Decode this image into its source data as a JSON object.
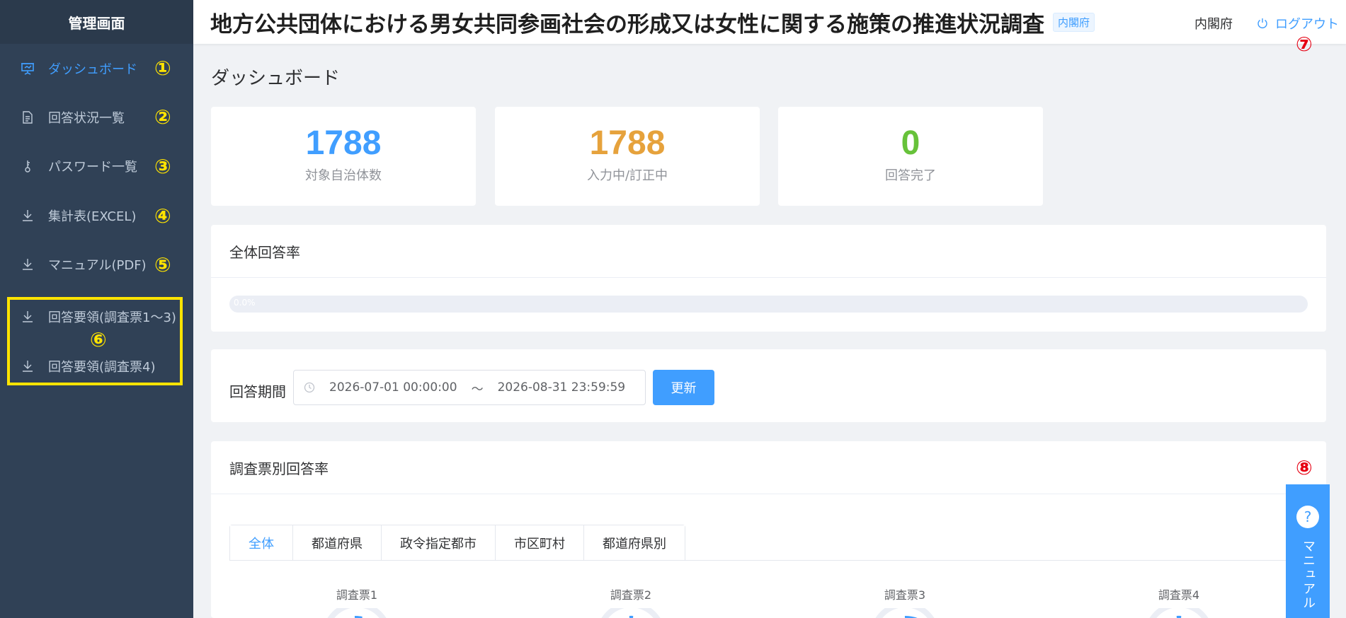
{
  "sidebar": {
    "title": "管理画面",
    "items": [
      {
        "label": "ダッシュボード",
        "icon": "dashboard-icon",
        "marker": "①"
      },
      {
        "label": "回答状況一覧",
        "icon": "document-icon",
        "marker": "②"
      },
      {
        "label": "パスワード一覧",
        "icon": "key-icon",
        "marker": "③"
      },
      {
        "label": "集計表(EXCEL)",
        "icon": "download-icon",
        "marker": "④"
      },
      {
        "label": "マニュアル(PDF)",
        "icon": "download-icon",
        "marker": "⑤"
      },
      {
        "label": "回答要領(調査票1～3)",
        "icon": "download-icon"
      },
      {
        "label": "回答要領(調査票4)",
        "icon": "download-icon"
      }
    ],
    "group_marker": "⑥"
  },
  "header": {
    "title": "地方公共団体における男女共同参画社会の形成又は女性に関する施策の推進状況調査",
    "tag": "内閣府",
    "user": "内閣府",
    "logout": "ログアウト",
    "logout_marker": "⑦"
  },
  "main": {
    "heading": "ダッシュボード",
    "stats": [
      {
        "value": "1788",
        "label": "対象自治体数",
        "color": "#409eff"
      },
      {
        "value": "1788",
        "label": "入力中/訂正中",
        "color": "#e6a23c"
      },
      {
        "value": "0",
        "label": "回答完了",
        "color": "#67c23a"
      }
    ],
    "overall": {
      "title": "全体回答率",
      "progress_text": "0.0%",
      "progress": 0.0
    },
    "period": {
      "label": "回答期間",
      "start": "2026-07-01 00:00:00",
      "separator": "～",
      "end": "2026-08-31 23:59:59",
      "refresh": "更新"
    },
    "by_survey": {
      "title": "調査票別回答率",
      "marker": "⑧",
      "tabs": [
        "全体",
        "都道府県",
        "政令指定都市",
        "市区町村",
        "都道府県別"
      ],
      "surveys": [
        "調査票1",
        "調査票2",
        "調査票3",
        "調査票4"
      ]
    }
  },
  "help": {
    "label": "マニュアル",
    "icon_text": "?"
  },
  "colors": {
    "sidebar_bg": "#304156",
    "accent": "#409eff",
    "marker_yellow": "#ffe400",
    "marker_red": "#e60012"
  }
}
